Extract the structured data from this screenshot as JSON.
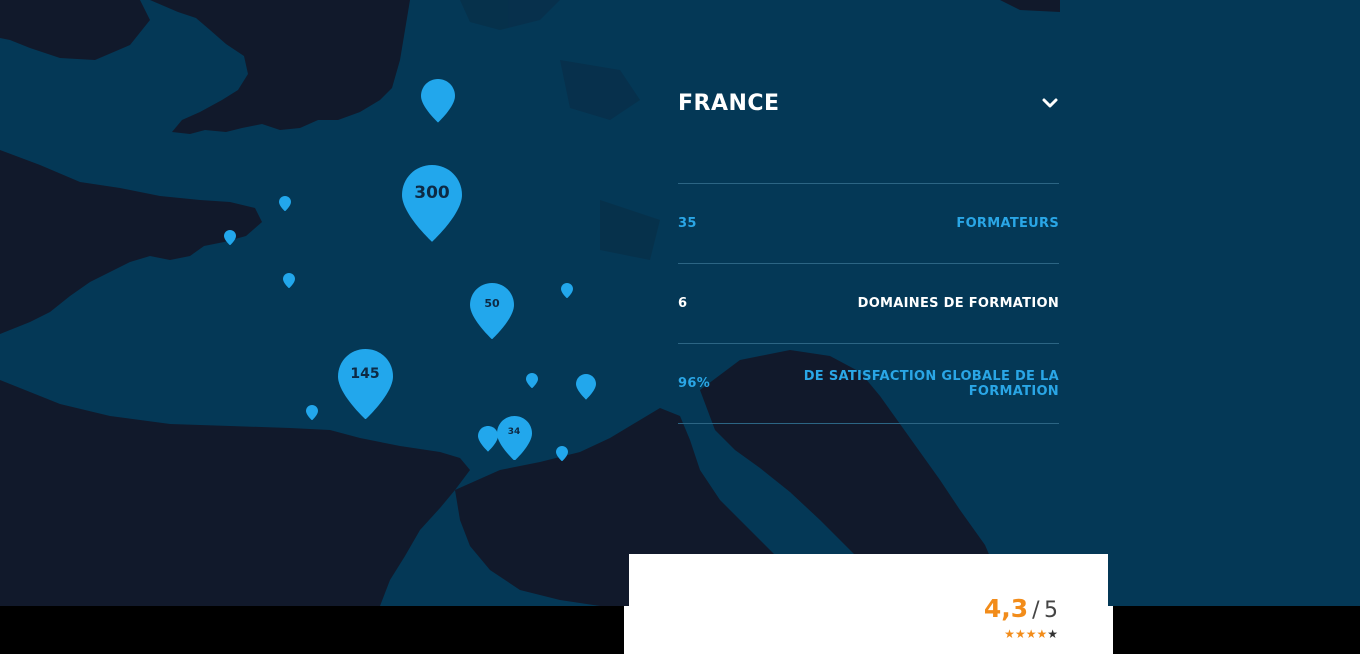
{
  "colors": {
    "sea": "#043856",
    "land": "#11192b",
    "pin": "#22a7ec",
    "accent_blue": "#2aa6e6",
    "rating_orange": "#f28c1a"
  },
  "map": {
    "pins": [
      {
        "name": "pin-paris",
        "count": "300"
      },
      {
        "name": "pin-lille",
        "count": ""
      },
      {
        "name": "pin-lyon",
        "count": "50"
      },
      {
        "name": "pin-bordeaux",
        "count": "145"
      },
      {
        "name": "pin-montpellier",
        "count": "34"
      },
      {
        "name": "pin-rennes",
        "count": ""
      },
      {
        "name": "pin-nantes",
        "count": ""
      },
      {
        "name": "pin-la-rochelle",
        "count": ""
      },
      {
        "name": "pin-biarritz",
        "count": ""
      },
      {
        "name": "pin-geneva",
        "count": ""
      },
      {
        "name": "pin-grenoble",
        "count": ""
      },
      {
        "name": "pin-valence",
        "count": ""
      },
      {
        "name": "pin-nimes",
        "count": ""
      },
      {
        "name": "pin-toulon",
        "count": ""
      },
      {
        "name": "pin-saint-brieuc",
        "count": ""
      }
    ]
  },
  "panel": {
    "country": "FRANCE",
    "stats": [
      {
        "value": "35",
        "label": "FORMATEURS"
      },
      {
        "value": "6",
        "label": "DOMAINES DE FORMATION"
      },
      {
        "value": "96%",
        "label": "DE SATISFACTION GLOBALE DE LA FORMATION"
      }
    ]
  },
  "rating": {
    "score": "4,3",
    "separator": "/",
    "max": "5",
    "stars": 4
  }
}
